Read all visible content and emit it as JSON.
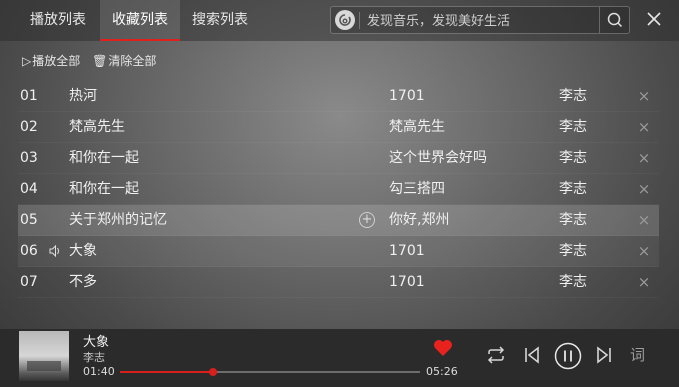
{
  "tabs": [
    {
      "label": "播放列表"
    },
    {
      "label": "收藏列表"
    },
    {
      "label": "搜索列表"
    }
  ],
  "search": {
    "placeholder": "发现音乐，发现美好生活"
  },
  "actions": {
    "play_all": "播放全部",
    "clear_all": "清除全部"
  },
  "songs": [
    {
      "num": "01",
      "title": "热河",
      "album": "1701",
      "artist": "李志"
    },
    {
      "num": "02",
      "title": "梵高先生",
      "album": "梵高先生",
      "artist": "李志"
    },
    {
      "num": "03",
      "title": "和你在一起",
      "album": "这个世界会好吗",
      "artist": "李志"
    },
    {
      "num": "04",
      "title": "和你在一起",
      "album": "勾三搭四",
      "artist": "李志"
    },
    {
      "num": "05",
      "title": "关于郑州的记忆",
      "album": "你好,郑州",
      "artist": "李志"
    },
    {
      "num": "06",
      "title": "大象",
      "album": "1701",
      "artist": "李志"
    },
    {
      "num": "07",
      "title": "不多",
      "album": "1701",
      "artist": "李志"
    }
  ],
  "player": {
    "title": "大象",
    "artist": "李志",
    "current_time": "01:40",
    "total_time": "05:26",
    "progress": 0.31,
    "lyric_label": "词"
  },
  "colors": {
    "accent": "#d7201c"
  },
  "icons": [
    "netease-logo-icon",
    "search-icon",
    "close-icon",
    "play-icon",
    "trash-icon",
    "speaker-icon",
    "add-icon",
    "delete-icon",
    "heart-icon",
    "loop-icon",
    "prev-icon",
    "pause-icon",
    "next-icon"
  ]
}
